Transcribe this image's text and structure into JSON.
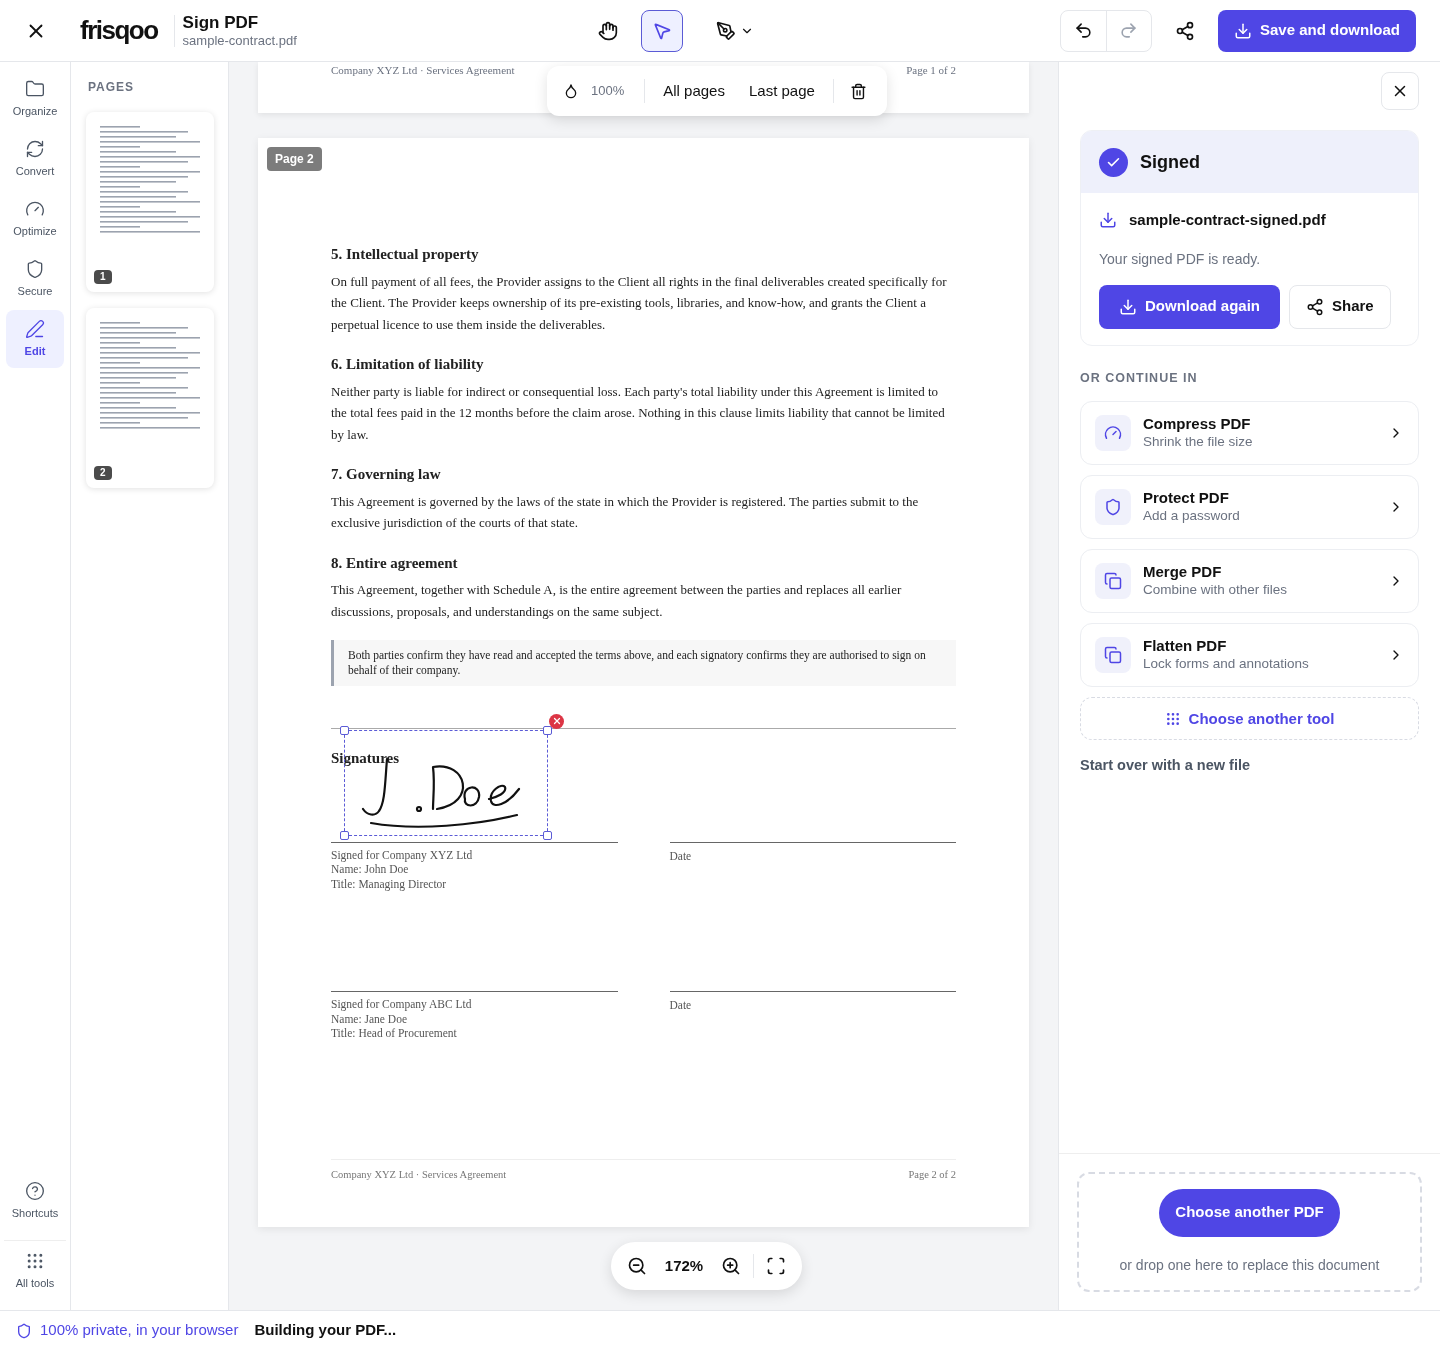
{
  "topbar": {
    "logo": "frisqoo",
    "title": "Sign PDF",
    "filename": "sample-contract.pdf",
    "tools": [
      {
        "kind": "hand",
        "selected": false
      },
      {
        "kind": "select",
        "selected": true
      },
      {
        "kind": "pen",
        "selected": false
      }
    ],
    "save_button": "Save and download"
  },
  "rail": {
    "items": [
      {
        "label": "Organize",
        "selected": false
      },
      {
        "label": "Convert",
        "selected": false
      },
      {
        "label": "Optimize",
        "selected": false
      },
      {
        "label": "Secure",
        "selected": false
      },
      {
        "label": "Edit",
        "selected": true
      }
    ],
    "bottom_items": [
      "Shortcuts",
      "All tools"
    ]
  },
  "pages_panel": {
    "title": "PAGES",
    "pages": [
      {
        "number": "1"
      },
      {
        "number": "2"
      }
    ]
  },
  "float_toolbar": {
    "opacity": "100%",
    "buttons": [
      "All pages",
      "Last page"
    ]
  },
  "document": {
    "prev_footer": {
      "left": "Company XYZ Ltd · Services Agreement",
      "right": "Page 1 of 2"
    },
    "page_badge": "Page 2",
    "sections": [
      {
        "heading": "5. Intellectual property",
        "body": "On full payment of all fees, the Provider assigns to the Client all rights in the final deliverables created specifically for the Client. The Provider keeps ownership of its pre-existing tools, libraries, and know-how, and grants the Client a perpetual licence to use them inside the deliverables."
      },
      {
        "heading": "6. Limitation of liability",
        "body": "Neither party is liable for indirect or consequential loss. Each party's total liability under this Agreement is limited to the total fees paid in the 12 months before the claim arose. Nothing in this clause limits liability that cannot be limited by law."
      },
      {
        "heading": "7. Governing law",
        "body": "This Agreement is governed by the laws of the state in which the Provider is registered. The parties submit to the exclusive jurisdiction of the courts of that state."
      },
      {
        "heading": "8. Entire agreement",
        "body": "This Agreement, together with Schedule A, is the entire agreement between the parties and replaces all earlier discussions, proposals, and understandings on the same subject."
      }
    ],
    "callout": "Both parties confirm they have read and accepted the terms above, and each signatory confirms they are authorised to sign on behalf of their company.",
    "signatures_heading": "Signatures",
    "signature_rows": [
      {
        "lines": [
          "Signed for Company XYZ Ltd",
          "Name: John Doe",
          "Title: Managing Director"
        ],
        "date": "Date",
        "signed": true
      },
      {
        "lines": [
          "Signed for Company ABC Ltd",
          "Name: Jane Doe",
          "Title: Head of Procurement"
        ],
        "date": "Date",
        "signed": false
      }
    ],
    "footer": {
      "left": "Company XYZ Ltd · Services Agreement",
      "right": "Page 2 of 2"
    }
  },
  "zoom": {
    "value": "172%"
  },
  "right_panel": {
    "status": "Signed",
    "file": "sample-contract-signed.pdf",
    "message": "Your signed PDF is ready.",
    "download_button": "Download again",
    "share_button": "Share",
    "continue_title": "OR CONTINUE IN",
    "tools": [
      {
        "title": "Compress PDF",
        "subtitle": "Shrink the file size"
      },
      {
        "title": "Protect PDF",
        "subtitle": "Add a password"
      },
      {
        "title": "Merge PDF",
        "subtitle": "Combine with other files"
      },
      {
        "title": "Flatten PDF",
        "subtitle": "Lock forms and annotations"
      }
    ],
    "another_tool": "Choose another tool",
    "start_over": "Start over with a new file",
    "dropzone": {
      "button": "Choose another PDF",
      "hint": "or drop one here to replace this document"
    }
  },
  "status_bar": {
    "privacy": "100% private, in your browser",
    "progress": "Building your PDF..."
  }
}
